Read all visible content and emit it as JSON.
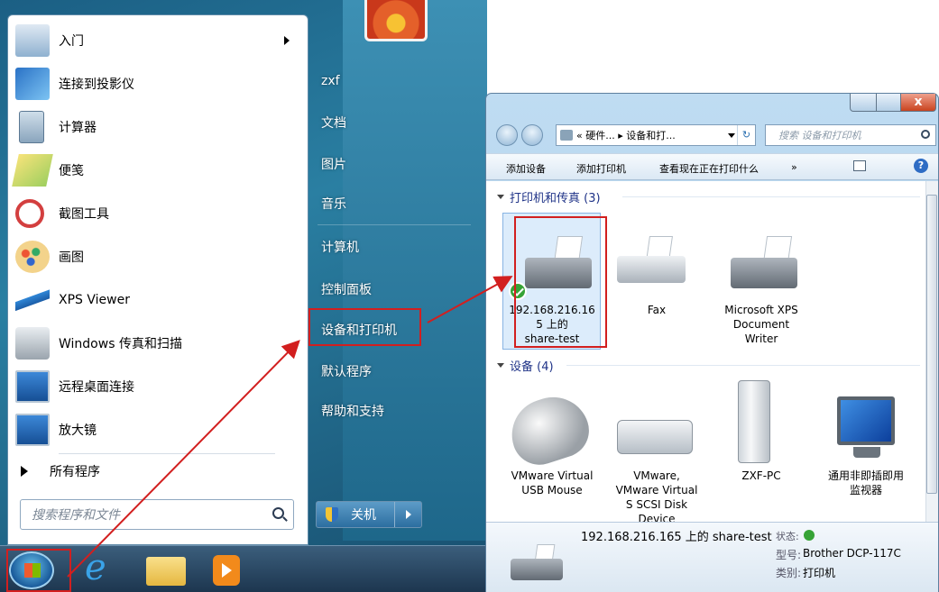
{
  "start_menu": {
    "programs": [
      {
        "label": "入门",
        "icon": "getting-started-icon",
        "has_submenu": true
      },
      {
        "label": "连接到投影仪",
        "icon": "projector-icon"
      },
      {
        "label": "计算器",
        "icon": "calculator-icon"
      },
      {
        "label": "便笺",
        "icon": "sticky-notes-icon"
      },
      {
        "label": "截图工具",
        "icon": "snipping-tool-icon"
      },
      {
        "label": "画图",
        "icon": "paint-icon"
      },
      {
        "label": "XPS Viewer",
        "icon": "xps-viewer-icon"
      },
      {
        "label": "Windows 传真和扫描",
        "icon": "fax-scan-icon"
      },
      {
        "label": "远程桌面连接",
        "icon": "remote-desktop-icon"
      },
      {
        "label": "放大镜",
        "icon": "magnifier-icon"
      }
    ],
    "all_programs": "所有程序",
    "search_placeholder": "搜索程序和文件",
    "right_items": [
      "zxf",
      "文档",
      "图片",
      "音乐",
      "计算机",
      "控制面板",
      "设备和打印机",
      "默认程序",
      "帮助和支持"
    ],
    "shutdown_label": "关机"
  },
  "explorer": {
    "breadcrumb": "« 硬件... ▸ 设备和打...",
    "search_placeholder": "搜索 设备和打印机",
    "toolbar": [
      "添加设备",
      "添加打印机",
      "查看现在正在打印什么",
      "»"
    ],
    "groups": [
      {
        "title": "打印机和传真 (3)"
      },
      {
        "title": "设备 (4)"
      }
    ],
    "printers": [
      {
        "name": "192.168.216.165 上的 share-test",
        "line1": "192.168.216.16",
        "line2": "5 上的",
        "line3": "share-test"
      },
      {
        "name": "Fax"
      },
      {
        "name": "Microsoft XPS Document Writer",
        "line1": "Microsoft XPS",
        "line2": "Document",
        "line3": "Writer"
      }
    ],
    "devices": [
      {
        "line1": "VMware Virtual",
        "line2": "USB Mouse"
      },
      {
        "line1": "VMware,",
        "line2": "VMware Virtual",
        "line3": "S SCSI Disk",
        "line4": "Device"
      },
      {
        "line1": "ZXF-PC"
      },
      {
        "line1": "通用非即插即用",
        "line2": "监视器"
      }
    ],
    "details": {
      "title": "192.168.216.165 上的 share-test",
      "status_label": "状态:",
      "model_label": "型号:",
      "model_value": "Brother DCP-117C",
      "category_label": "类别:",
      "category_value": "打印机"
    },
    "window_buttons": {
      "close": "x"
    }
  },
  "colors": {
    "highlight": "#d21f1f",
    "accent": "#1e3287"
  }
}
